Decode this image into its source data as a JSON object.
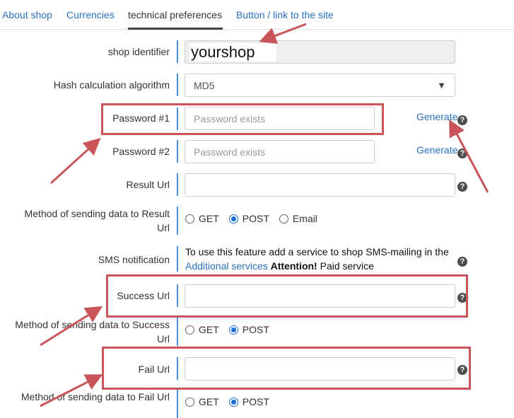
{
  "tabs": [
    {
      "label": "About shop"
    },
    {
      "label": "Currencies"
    },
    {
      "label": "technical preferences"
    },
    {
      "label": "Button / link to the site"
    }
  ],
  "form": {
    "shop_identifier": {
      "label": "shop identifier",
      "value": "yourshop"
    },
    "hash": {
      "label": "Hash calculation algorithm",
      "value": "MD5"
    },
    "password1": {
      "label": "Password #1",
      "placeholder": "Password exists",
      "generate": "Generate"
    },
    "password2": {
      "label": "Password #2",
      "placeholder": "Password exists",
      "generate": "Generate"
    },
    "result_url": {
      "label": "Result Url",
      "value": ""
    },
    "result_method": {
      "label": "Method of sending data to Result Url",
      "options": [
        "GET",
        "POST",
        "Email"
      ],
      "selected": "POST"
    },
    "sms": {
      "label": "SMS notification",
      "text_before": "To use this feature add a service to shop SMS-mailing in the",
      "link": "Additional services",
      "attention": "Attention!",
      "text_after": "Paid service"
    },
    "success_url": {
      "label": "Success Url",
      "value": ""
    },
    "success_method": {
      "label": "Method of sending data to Success Url",
      "options": [
        "GET",
        "POST"
      ],
      "selected": "POST"
    },
    "fail_url": {
      "label": "Fail Url",
      "value": ""
    },
    "fail_method": {
      "label": "Method of sending data to Fail Url",
      "options": [
        "GET",
        "POST"
      ],
      "selected": "POST"
    }
  },
  "icons": {
    "help": "question-circle-icon",
    "dropdown": "caret-down-icon"
  },
  "colors": {
    "link": "#2a6fc0",
    "accent_bar": "#4e8fd6",
    "annotation": "#c9555b",
    "radio_checked": "#1a6fd6"
  }
}
